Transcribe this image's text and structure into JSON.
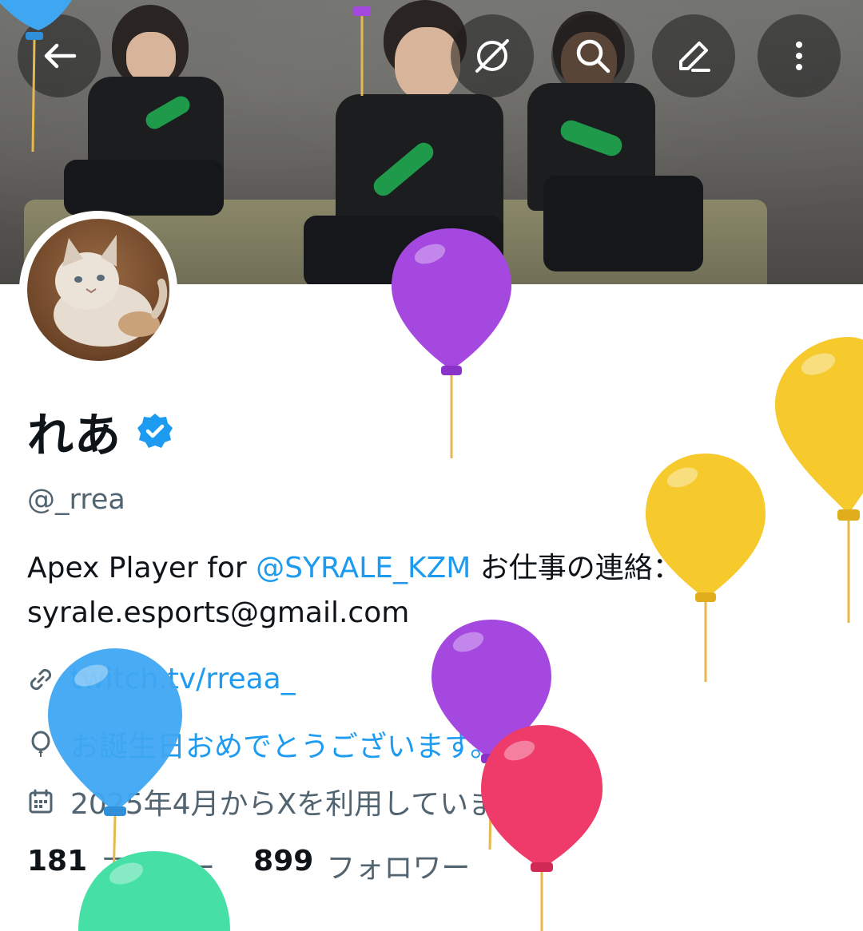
{
  "header": {
    "icons": [
      "back-arrow-icon",
      "grok-icon",
      "search-icon",
      "edit-icon",
      "more-icon"
    ]
  },
  "profile": {
    "display_name": "れあ",
    "verified_icon": "verified-badge-icon",
    "handle": "@_rrea",
    "bio_prefix": "Apex Player for ",
    "bio_mention": "@SYRALE_KZM",
    "bio_suffix": " お仕事の連絡：syrale.esports@gmail.com",
    "website": "twitch.tv/rreaa_",
    "location": "お誕生日おめでとうございます。",
    "joined": "2025年4月からXを利用しています",
    "following_count": "181",
    "following_label": "フォロー",
    "followers_count": "899",
    "followers_label": "フォロワー"
  },
  "colors": {
    "link": "#1d9bf0",
    "muted": "#536471",
    "text": "#0f1419",
    "balloon_purple": "#a448e0",
    "balloon_yellow": "#f6c92c",
    "balloon_blue": "#3fa6f2",
    "balloon_red": "#ee3b6a",
    "balloon_green": "#46e0a6"
  }
}
